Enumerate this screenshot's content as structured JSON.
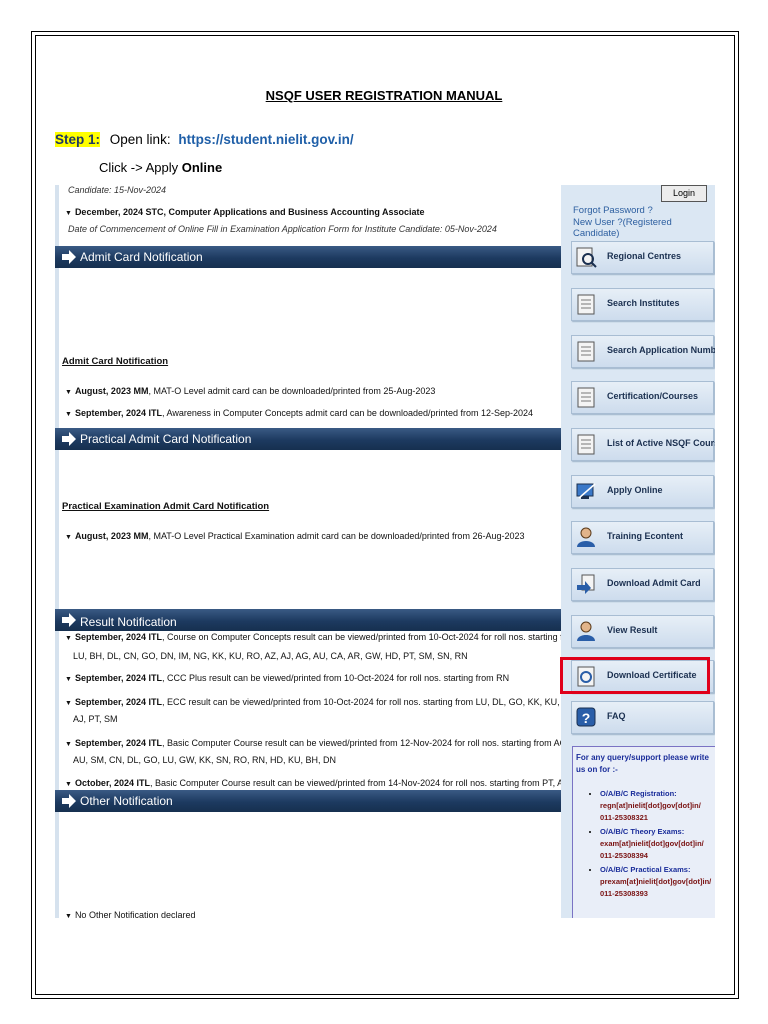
{
  "doc": {
    "title": "NSQF USER REGISTRATION MANUAL",
    "step_label": "Step 1:",
    "open_link_text": "Open link:",
    "link_url": "https://student.nielit.gov.in/",
    "click_text": "Click -> Apply",
    "click_bold": "Online"
  },
  "screenshot": {
    "top_line": "Candidate: 15-Nov-2024",
    "top_item": {
      "bold": "December, 2024 STC, Computer Applications and Business Accounting Associate",
      "text": ""
    },
    "top_sub": "Date of Commencement of Online Fill in Examination Application Form for Institute Candidate: 05-Nov-2024",
    "bars": {
      "admit": "Admit Card Notification",
      "practical": "Practical Admit Card Notification",
      "result": "Result Notification",
      "other": "Other Notification"
    },
    "admit_head": "Admit Card Notification",
    "admit_items": [
      {
        "bold": "August, 2023 MM",
        "text": ", MAT-O Level admit card can be downloaded/printed from 25-Aug-2023"
      },
      {
        "bold": "September, 2024 ITL",
        "text": ", Awareness in Computer Concepts admit card can be downloaded/printed from 12-Sep-2024"
      }
    ],
    "practical_head": "Practical Examination Admit Card Notification",
    "practical_items": [
      {
        "bold": "August, 2023 MM",
        "text": ", MAT-O Level Practical Examination admit card can be downloaded/printed from 26-Aug-2023"
      }
    ],
    "result_items": [
      {
        "bold": "September, 2024 ITL",
        "text": ", Course on Computer Concepts result can be viewed/printed from 10-Oct-2024 for roll nos. starting from",
        "cont": "LU, BH, DL, CN, GO, DN, IM, NG, KK, KU, RO, AZ, AJ, AG, AU, CA, AR, GW, HD, PT, SM, SN, RN"
      },
      {
        "bold": "September, 2024 ITL",
        "text": ", CCC Plus result can be viewed/printed from 10-Oct-2024 for roll nos. starting from RN",
        "cont": ""
      },
      {
        "bold": "September, 2024 ITL",
        "text": ", ECC result can be viewed/printed from 10-Oct-2024 for roll nos. starting from LU, DL, GO, KK, KU, DN,",
        "cont": "AJ, PT, SM"
      },
      {
        "bold": "September, 2024 ITL",
        "text": ", Basic Computer Course result can be viewed/printed from 12-Nov-2024 for roll nos. starting from AG, AJ,",
        "cont": "AU, SM, CN, DL, GO, LU, GW, KK, SN, RO, RN, HD, KU, BH, DN"
      },
      {
        "bold": "October, 2024 ITL",
        "text": ", Basic Computer Course result can be viewed/printed from 14-Nov-2024 for roll nos. starting from PT, AJ,",
        "cont": ""
      }
    ],
    "other_item": "No Other Notification declared",
    "login": "Login",
    "forgot": "Forgot Password ?",
    "new_user": "New User ?(Registered Candidate)",
    "nav": [
      {
        "label": "Regional Centres",
        "icon": "regional-centres-icon"
      },
      {
        "label": "Search Institutes",
        "icon": "document-icon"
      },
      {
        "label": "Search Application Number",
        "icon": "document-icon"
      },
      {
        "label": "Certification/Courses",
        "icon": "document-icon"
      },
      {
        "label": "List of Active NSQF Courses",
        "icon": "document-icon"
      },
      {
        "label": "Apply Online",
        "icon": "apply-online-icon"
      },
      {
        "label": "Training Econtent",
        "icon": "user-icon"
      },
      {
        "label": "Download Admit Card",
        "icon": "download-admit-card-icon"
      },
      {
        "label": "View Result",
        "icon": "user-icon"
      },
      {
        "label": "Download Certificate",
        "icon": "certificate-icon"
      },
      {
        "label": "FAQ",
        "icon": "faq-icon"
      }
    ],
    "support": {
      "intro": "For any query/support please write us on for :-",
      "items": [
        {
          "label": "O/A/B/C Registration:",
          "email": "regn[at]nielit[dot]gov[dot]in/",
          "phone": "011-25308321"
        },
        {
          "label": "O/A/B/C Theory Exams:",
          "email": "exam[at]nielit[dot]gov[dot]in/",
          "phone": "011-25308394"
        },
        {
          "label": "O/A/B/C Practical Exams:",
          "email": "prexam[at]nielit[dot]gov[dot]in/",
          "phone": "011-25308393"
        }
      ]
    }
  },
  "colors": {
    "bar": "#1d3a60",
    "highlight": "#e0001a",
    "step_label_bg": "#ffff00",
    "link": "#1f5fa8"
  }
}
